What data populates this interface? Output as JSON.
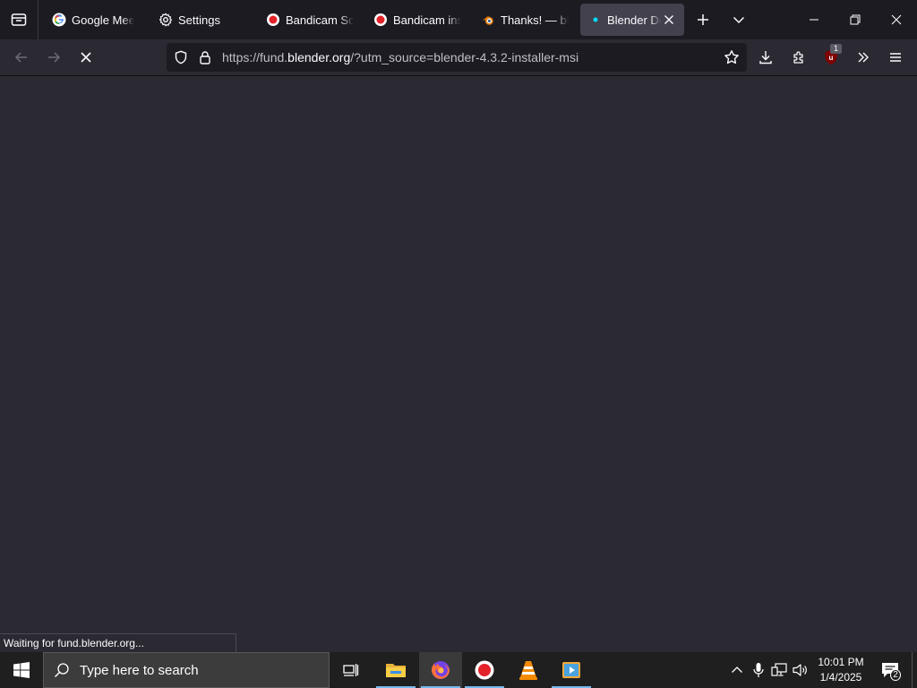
{
  "tabs": [
    {
      "label": "Google Meet",
      "icon": "google-icon",
      "active": false
    },
    {
      "label": "Settings",
      "icon": "gear-icon",
      "active": false
    },
    {
      "label": "Bandicam Screen Recorder",
      "icon": "bandicam-icon",
      "active": false
    },
    {
      "label": "Bandicam installed",
      "icon": "bandicam-icon",
      "active": false
    },
    {
      "label": "Thanks! — blender.org",
      "icon": "blender-icon",
      "active": false
    },
    {
      "label": "Blender Development Fund",
      "icon": "loading-dot-icon",
      "active": true
    }
  ],
  "urlbar": {
    "prefix": "https://fund.",
    "host": "blender.org",
    "suffix": "/?utm_source=blender-4.3.2-installer-msi"
  },
  "toolbar": {
    "extension_badge": "1"
  },
  "status": {
    "text": "Waiting for fund.blender.org..."
  },
  "taskbar": {
    "search_placeholder": "Type here to search",
    "apps": [
      "task-view-icon",
      "file-explorer-icon",
      "firefox-icon",
      "bandicam-icon",
      "vlc-icon",
      "media-player-icon"
    ],
    "clock_time": "10:01 PM",
    "clock_date": "1/4/2025",
    "notification_count": "2"
  },
  "colors": {
    "accent": "#0060df",
    "tabstrip_bg": "#1c1b22",
    "toolbar_bg": "#2b2a33",
    "active_tab_bg": "#42414d",
    "taskbar_bg": "#1f1f1f",
    "taskbar_underline": "#76b9ed"
  }
}
